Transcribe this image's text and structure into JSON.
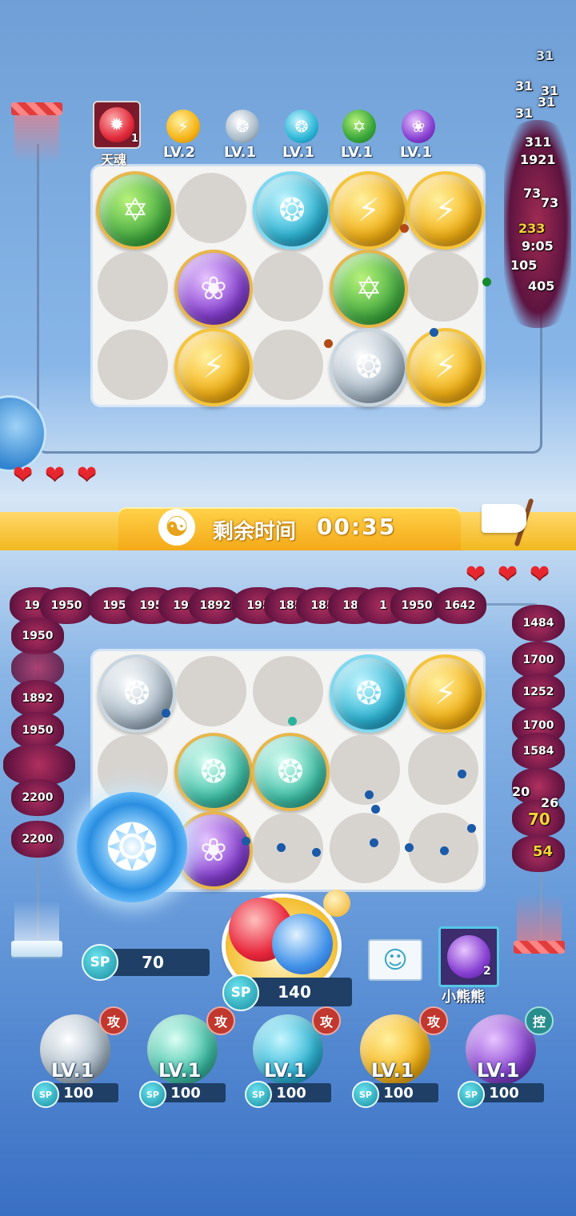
{
  "opponent": {
    "rune_label": "天魂",
    "rune_count": "1",
    "levels": [
      "LV.2",
      "LV.1",
      "LV.1",
      "LV.1",
      "LV.1"
    ],
    "hearts": 3,
    "damage_numbers": [
      "31",
      "31",
      "31",
      "31",
      "31",
      "311",
      "1921",
      "73",
      "73",
      "233",
      "9:05",
      "105",
      "405"
    ]
  },
  "timer": {
    "label": "剩余时间",
    "value": "00:35"
  },
  "player": {
    "hearts": 3,
    "sp_left": "70",
    "sp_center": "140",
    "partner_name": "小熊熊",
    "partner_count": "2",
    "enemy_top_row": [
      "195",
      "1950",
      "195",
      "195",
      "195",
      "1892",
      "195",
      "185",
      "185",
      "182",
      "1",
      "1950",
      "1642"
    ],
    "enemy_left_col": [
      "1950",
      "1950",
      "1892",
      "1950",
      "2200",
      "2200"
    ],
    "enemy_right_col": [
      "1484",
      "1700",
      "1252",
      "1700",
      "1584",
      "20",
      "26",
      "70",
      "54"
    ]
  },
  "cards": [
    {
      "level": "LV.1",
      "sp": "100",
      "tag": "攻",
      "sp_label": "SP"
    },
    {
      "level": "LV.1",
      "sp": "100",
      "tag": "攻",
      "sp_label": "SP"
    },
    {
      "level": "LV.1",
      "sp": "100",
      "tag": "攻",
      "sp_label": "SP"
    },
    {
      "level": "LV.1",
      "sp": "100",
      "tag": "攻",
      "sp_label": "SP"
    },
    {
      "level": "LV.1",
      "sp": "100",
      "tag": "控",
      "sp_label": "SP"
    }
  ],
  "sp_label": "SP",
  "colors": {
    "timer_band": "#f7c531",
    "heart": "#e8262d",
    "sp_bar": "#1f3f66"
  }
}
